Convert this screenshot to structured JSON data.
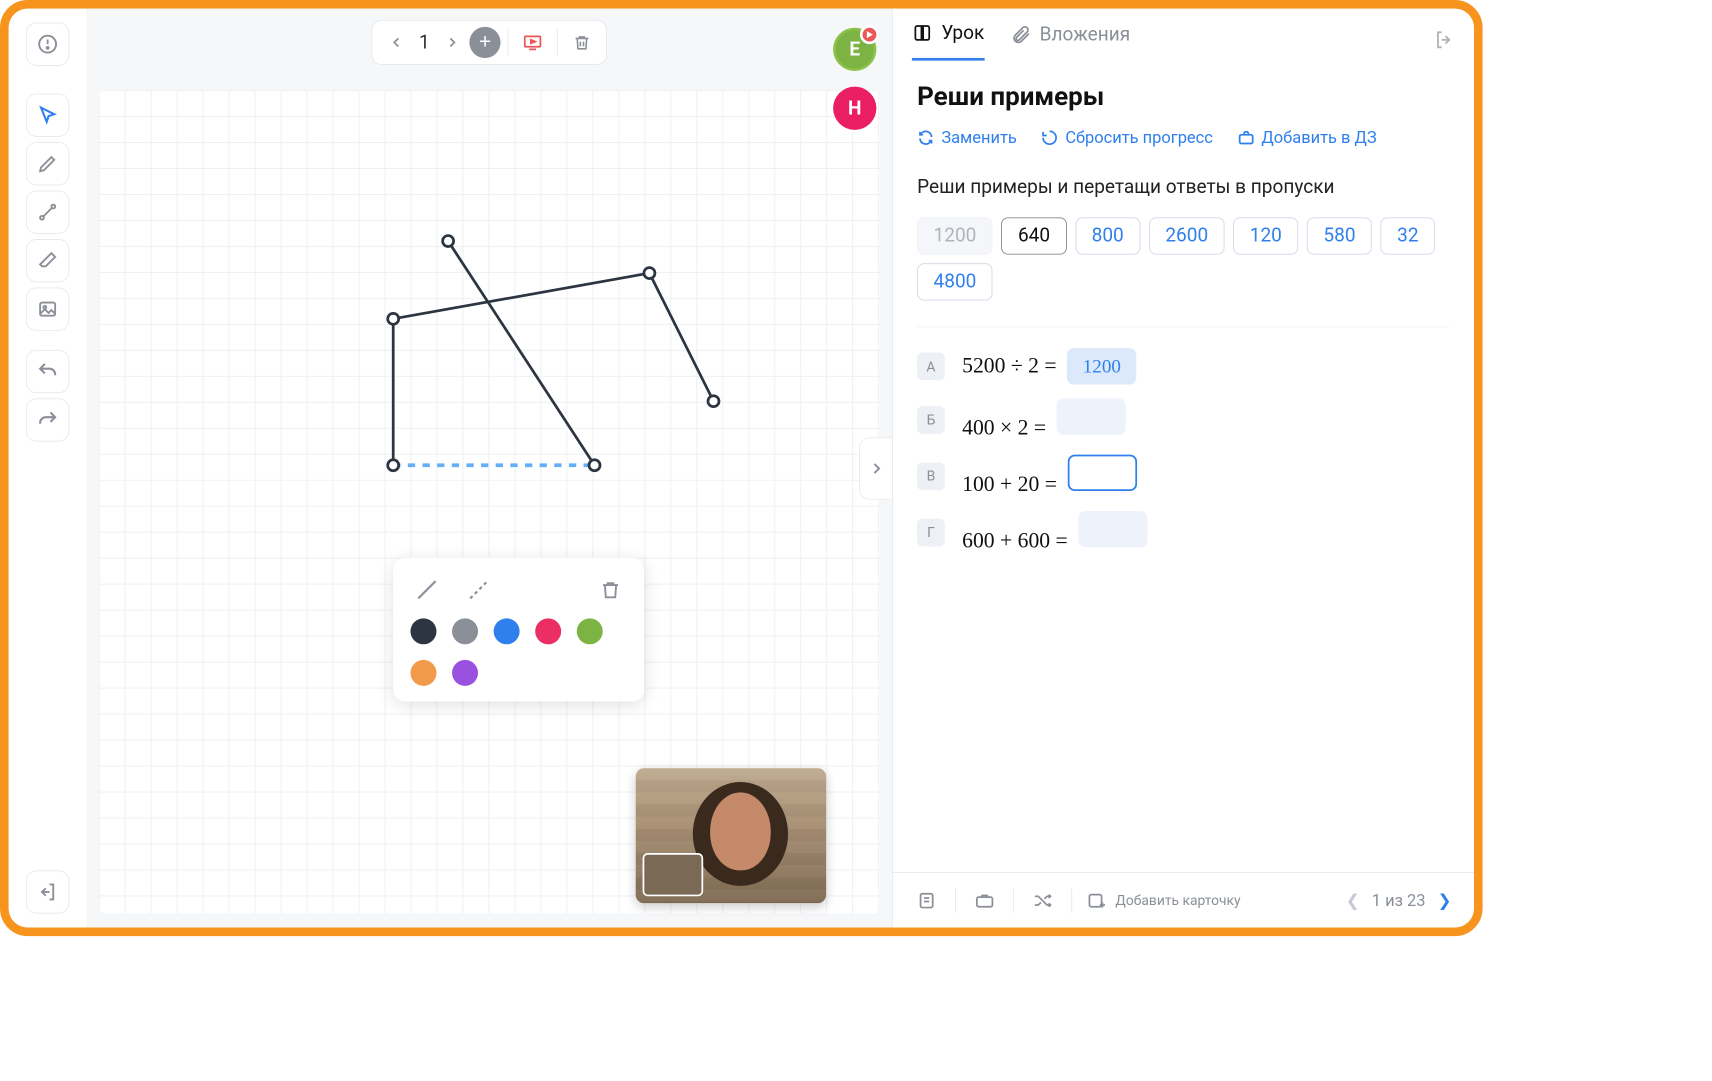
{
  "topbar": {
    "page_number": "1"
  },
  "avatars": {
    "e": "E",
    "h": "H"
  },
  "line_styles": {
    "solid": "solid",
    "dashed": "dashed"
  },
  "colors": [
    "#2c3541",
    "#8a8f98",
    "#2f80ed",
    "#eb2f64",
    "#7cb342",
    "#f2994a",
    "#9b51e0"
  ],
  "right": {
    "tab_lesson": "Урок",
    "tab_attachments": "Вложения",
    "title": "Реши примеры",
    "action_replace": "Заменить",
    "action_reset": "Сбросить прогресс",
    "action_hw": "Добавить в ДЗ",
    "instruction": "Реши примеры и перетащи ответы в пропуски",
    "chips": [
      {
        "v": "1200",
        "state": "disabled"
      },
      {
        "v": "640",
        "state": "dark"
      },
      {
        "v": "800",
        "state": "normal"
      },
      {
        "v": "2600",
        "state": "normal"
      },
      {
        "v": "120",
        "state": "normal"
      },
      {
        "v": "580",
        "state": "normal"
      },
      {
        "v": "32",
        "state": "normal"
      },
      {
        "v": "4800",
        "state": "normal"
      }
    ],
    "problems": [
      {
        "label": "А",
        "expr": "5200 ÷ 2 =",
        "slot": "1200",
        "slot_state": "filled"
      },
      {
        "label": "Б",
        "expr": "400 × 2 =",
        "slot": "",
        "slot_state": "empty"
      },
      {
        "label": "В",
        "expr": "100 + 20 =",
        "slot": "",
        "slot_state": "active"
      },
      {
        "label": "Г",
        "expr": "600 + 600 =",
        "slot": "",
        "slot_state": "empty"
      }
    ],
    "footer": {
      "add_card": "Добавить карточку",
      "pager": "1 из 23"
    }
  }
}
